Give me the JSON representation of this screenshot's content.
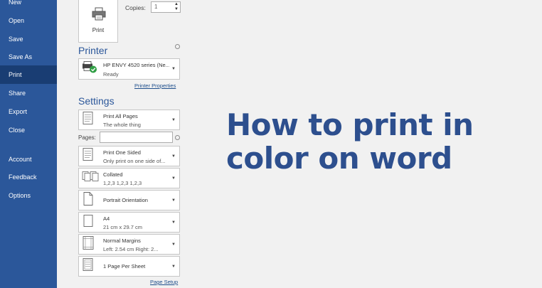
{
  "sidebar": {
    "items": [
      {
        "label": "New"
      },
      {
        "label": "Open"
      },
      {
        "label": "Save"
      },
      {
        "label": "Save As"
      },
      {
        "label": "Print",
        "active": true
      },
      {
        "label": "Share"
      },
      {
        "label": "Export"
      },
      {
        "label": "Close"
      },
      {
        "label": "Account"
      },
      {
        "label": "Feedback"
      },
      {
        "label": "Options"
      }
    ]
  },
  "print": {
    "button_label": "Print",
    "copies_label": "Copies:",
    "copies_value": "1"
  },
  "printer": {
    "heading": "Printer",
    "name": "HP ENVY 4520 series (Ne...",
    "status": "Ready",
    "properties_link": "Printer Properties"
  },
  "settings": {
    "heading": "Settings",
    "pages_label": "Pages:",
    "pages_value": "",
    "page_setup_link": "Page Setup",
    "options": [
      {
        "line1": "Print All Pages",
        "line2": "The whole thing",
        "icon": "pages-icon"
      },
      {
        "line1": "Print One Sided",
        "line2": "Only print on one side of...",
        "icon": "one-sided-icon"
      },
      {
        "line1": "Collated",
        "line2": "1,2,3    1,2,3    1,2,3",
        "icon": "collated-icon"
      },
      {
        "line1": "Portrait Orientation",
        "line2": "",
        "icon": "portrait-icon"
      },
      {
        "line1": "A4",
        "line2": "21 cm x 29.7 cm",
        "icon": "paper-size-icon"
      },
      {
        "line1": "Normal Margins",
        "line2": "Left:  2.54 cm    Right:  2...",
        "icon": "margins-icon"
      },
      {
        "line1": "1 Page Per Sheet",
        "line2": "",
        "icon": "pages-per-sheet-icon"
      }
    ]
  },
  "overlay": {
    "line1": "How to print in",
    "line2": "color on word"
  },
  "colors": {
    "sidebar": "#2b579a",
    "sidebar_active": "#193d73",
    "accent": "#2b579a",
    "headline": "#2d4f8e"
  }
}
